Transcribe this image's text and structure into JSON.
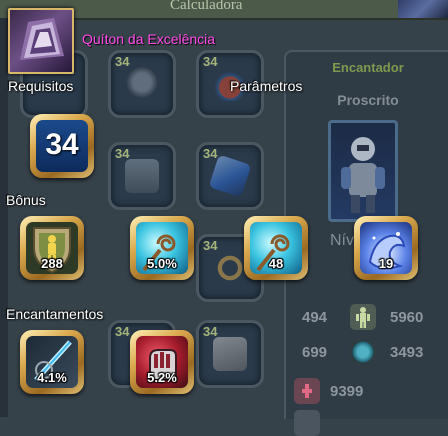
{
  "window": {
    "title": "Calculadora"
  },
  "item": {
    "name": "Quíton da Excelência",
    "name_color": "#ff4ce6"
  },
  "sections": {
    "requirements": "Requisitos",
    "parameters": "Parâmetros",
    "bonus": "Bônus",
    "enchantments": "Encantamentos"
  },
  "requirement_level": "34",
  "bonuses": [
    {
      "icon": "shield-figure-icon",
      "value": "288"
    },
    {
      "icon": "hypnotic-staff-icon",
      "value": "5.0%"
    },
    {
      "icon": "hypnotic-staff-icon",
      "value": "48"
    },
    {
      "icon": "blue-wave-icon",
      "value": "19"
    }
  ],
  "enchantments": [
    {
      "icon": "lightning-blade-icon",
      "value": "4.1%"
    },
    {
      "icon": "red-gauntlet-icon",
      "value": "5.2%"
    }
  ],
  "background": {
    "grid_levels": [
      "34",
      "34",
      "34",
      "34",
      "34",
      "34",
      "34",
      "34"
    ],
    "enchanter_title": "Encantador",
    "enchanter_class": "Proscrito",
    "level_label": "Nív",
    "stats": [
      {
        "left": "494",
        "right": "5960"
      },
      {
        "left": "699",
        "right": "3493"
      },
      {
        "right": "9399"
      }
    ]
  },
  "colors": {
    "accent_gold": "#d9a84d",
    "item_name": "#ff4ce6",
    "level_text": "#a4b27b"
  }
}
